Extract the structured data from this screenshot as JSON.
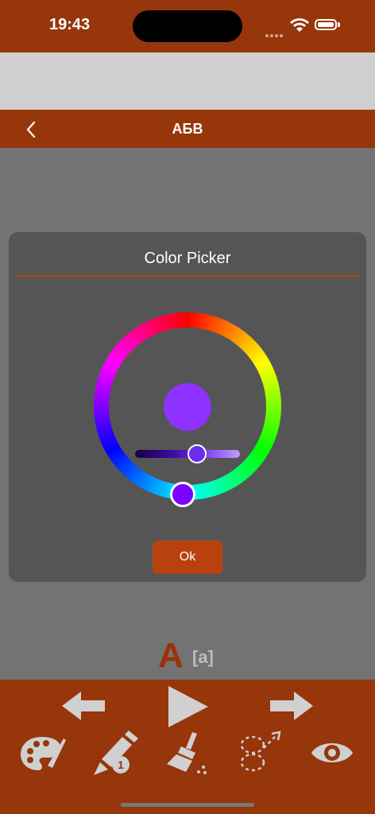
{
  "status_bar": {
    "time": "19:43"
  },
  "nav": {
    "title": "АБВ"
  },
  "dialog": {
    "title": "Color Picker",
    "ok_label": "Ok",
    "selected_color": "#8f31ff"
  },
  "letter": {
    "main": "A",
    "transcription": "[a]"
  },
  "colors": {
    "brand": "#97350b",
    "accent": "#b9410f"
  }
}
